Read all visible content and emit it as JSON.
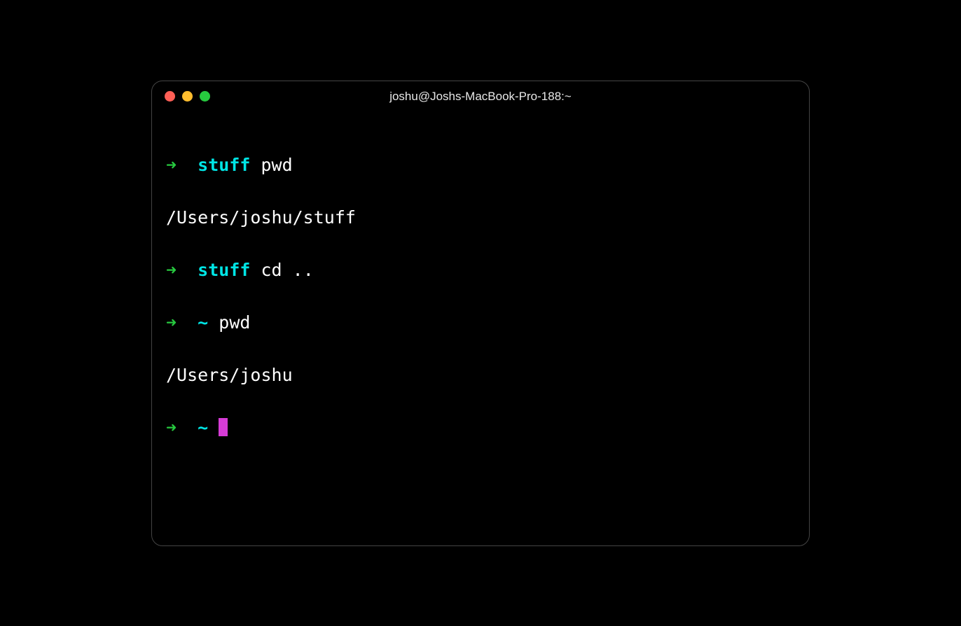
{
  "window": {
    "title": "joshu@Joshs-MacBook-Pro-188:~"
  },
  "prompt": {
    "arrow": "➜"
  },
  "lines": {
    "line1_dir": "stuff",
    "line1_cmd": "pwd",
    "line2_output": "/Users/joshu/stuff",
    "line3_dir": "stuff",
    "line3_cmd": "cd ..",
    "line4_dir": "~",
    "line4_cmd": "pwd",
    "line5_output": "/Users/joshu",
    "line6_dir": "~"
  }
}
